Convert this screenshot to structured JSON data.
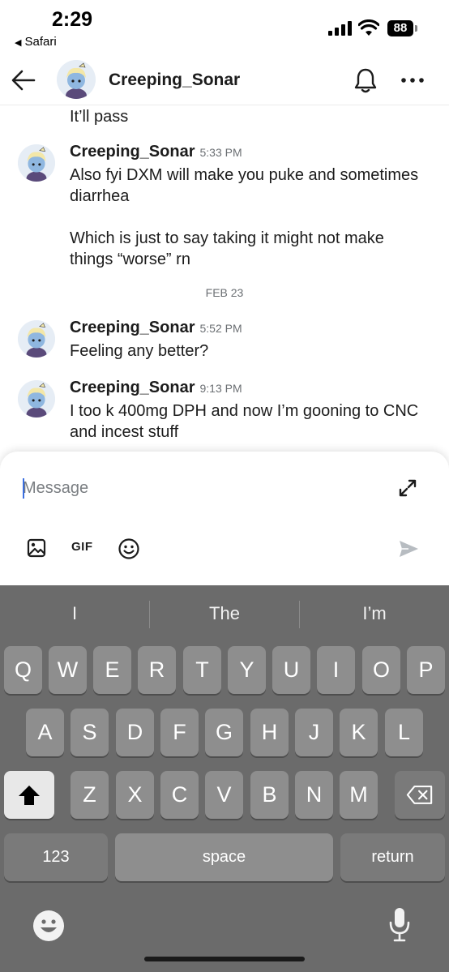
{
  "status_bar": {
    "time": "2:29",
    "back_app": "Safari",
    "battery": "88"
  },
  "header": {
    "title": "Creeping_Sonar",
    "icons": [
      "back-arrow-icon",
      "bell-icon",
      "more-icon"
    ]
  },
  "messages": {
    "continuation": "It’ll pass",
    "items": [
      {
        "author": "Creeping_Sonar",
        "time": "5:33 PM",
        "text": "Also fyi DXM will make you puke and sometimes diarrhea\n\nWhich is just to say taking it might not make things “worse” rn"
      },
      {
        "author": "Creeping_Sonar",
        "time": "5:52 PM",
        "text": "Feeling any better?"
      },
      {
        "author": "Creeping_Sonar",
        "time": "9:13 PM",
        "text": "I too k 400mg DPH and now I’m gooning to CNC and incest stuff"
      }
    ],
    "date_separator": "FEB 23"
  },
  "composer": {
    "placeholder": "Message",
    "gif_label": "GIF"
  },
  "keyboard": {
    "predictions": [
      "I",
      "The",
      "I’m"
    ],
    "row1": [
      "Q",
      "W",
      "E",
      "R",
      "T",
      "Y",
      "U",
      "I",
      "O",
      "P"
    ],
    "row2": [
      "A",
      "S",
      "D",
      "F",
      "G",
      "H",
      "J",
      "K",
      "L"
    ],
    "row3": [
      "Z",
      "X",
      "C",
      "V",
      "B",
      "N",
      "M"
    ],
    "numbers_label": "123",
    "space_label": "space",
    "return_label": "return"
  },
  "colors": {
    "accent_caret": "#3b6fe0",
    "keyboard_bg": "#6b6b6b",
    "key_bg": "#8e8e8e"
  }
}
